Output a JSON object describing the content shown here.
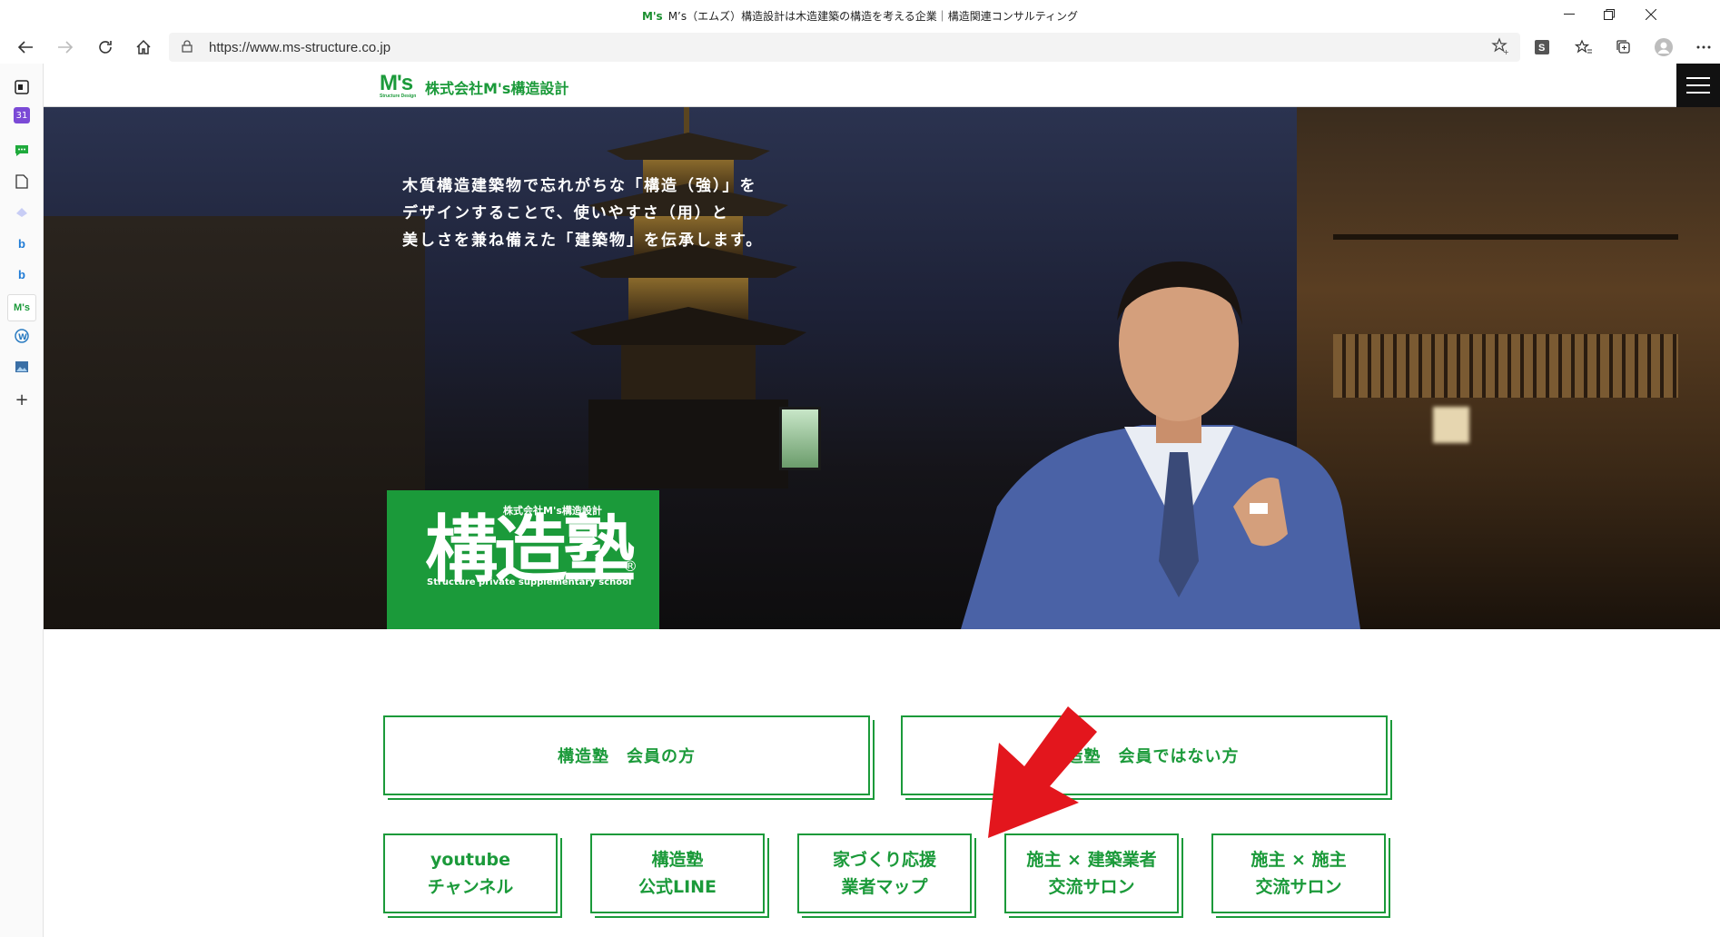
{
  "browser": {
    "window_title": "M’s（エムズ）構造設計は木造建築の構造を考える企業｜構造関連コンサルティング",
    "favicon_text": "M's",
    "url": "https://www.ms-structure.co.jp",
    "toolbar_icons": [
      "back-icon",
      "forward-icon",
      "refresh-icon",
      "home-icon"
    ],
    "right_icons": [
      "favorite-star-icon",
      "extension-s-icon",
      "favorites-list-icon",
      "collections-icon",
      "profile-icon",
      "more-icon"
    ]
  },
  "sidebar": {
    "items": [
      {
        "icon": "outlook-icon",
        "label": ""
      },
      {
        "icon": "calendar-icon",
        "label": "31"
      },
      {
        "icon": "chat-icon",
        "label": ""
      },
      {
        "icon": "document-icon",
        "label": ""
      },
      {
        "icon": "copilot-icon",
        "label": ""
      },
      {
        "icon": "bing-icon",
        "label": "b"
      },
      {
        "icon": "bing-icon",
        "label": "b"
      },
      {
        "icon": "ms-structure-icon",
        "label": "M's"
      },
      {
        "icon": "wordpress-icon",
        "label": ""
      },
      {
        "icon": "image-icon",
        "label": ""
      },
      {
        "icon": "add-icon",
        "label": "+"
      }
    ]
  },
  "site": {
    "logo_mark": "M's",
    "logo_sub": "Structure Design",
    "logo_text": "株式会社M's構造設計",
    "menu_icon": "hamburger-icon"
  },
  "hero": {
    "catch_lines": [
      "木質構造建築物で忘れがちな「構造（強）」を",
      "デザインすることで、使いやすさ（用）と",
      "美しさを兼ね備えた「建築物」を伝承します。"
    ],
    "badge": {
      "company": "株式会社M's構造設計",
      "title": "構造塾",
      "english": "Structure private supplementary school",
      "registered": "®"
    }
  },
  "buttons": {
    "member": "構造塾　会員の方",
    "non_member": "構造塾　会員ではない方",
    "youtube": [
      "youtube",
      "チャンネル"
    ],
    "line": [
      "構造塾",
      "公式LINE"
    ],
    "map": [
      "家づくり応援",
      "業者マップ"
    ],
    "salon_builder": [
      "施主 × 建築業者",
      "交流サロン"
    ],
    "salon_owner": [
      "施主 × 施主",
      "交流サロン"
    ]
  },
  "colors": {
    "brand_green": "#1b9a3a",
    "arrow_red": "#e3161d"
  }
}
